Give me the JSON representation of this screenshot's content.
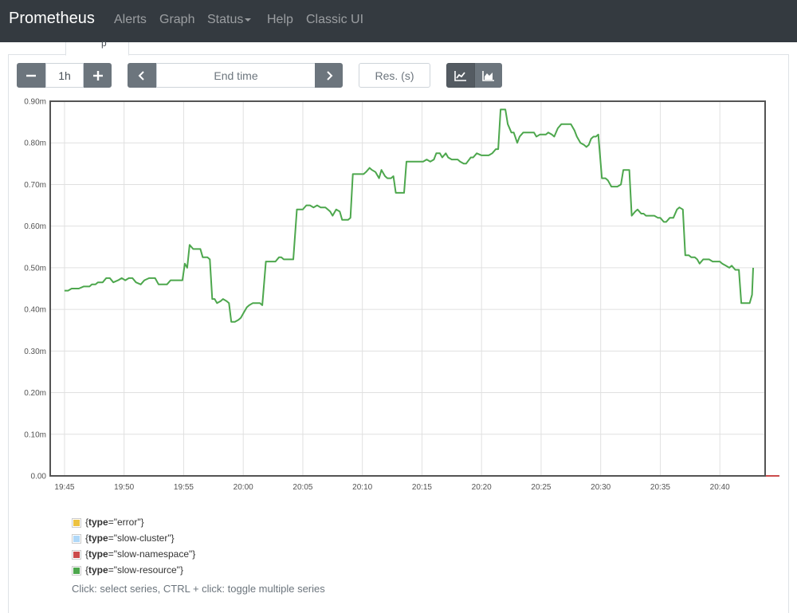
{
  "navbar": {
    "brand": "Prometheus",
    "items": [
      {
        "label": "Alerts"
      },
      {
        "label": "Graph"
      },
      {
        "label": "Status"
      },
      {
        "label": "Help"
      },
      {
        "label": "Classic UI"
      }
    ]
  },
  "tab": {
    "label": "p"
  },
  "controls": {
    "range_value": "1h",
    "decrease_icon": "minus-icon",
    "increase_icon": "plus-icon",
    "end_time_placeholder": "End time",
    "back_icon": "chevron-left-icon",
    "forward_icon": "chevron-right-icon",
    "resolution_placeholder": "Res. (s)",
    "line_mode_icon": "line-chart-icon",
    "stacked_mode_icon": "area-chart-icon"
  },
  "chart_data": {
    "type": "line",
    "ylim": [
      0,
      0.0009
    ],
    "yticks": [
      "0.00",
      "0.10m",
      "0.20m",
      "0.30m",
      "0.40m",
      "0.50m",
      "0.60m",
      "0.70m",
      "0.80m",
      "0.90m"
    ],
    "xticks": [
      "19:45",
      "19:50",
      "19:55",
      "20:00",
      "20:05",
      "20:10",
      "20:15",
      "20:20",
      "20:25",
      "20:30",
      "20:35",
      "20:40"
    ],
    "grid": true,
    "legend_placement": "bottom-left",
    "series": [
      {
        "name": "error",
        "color": "#edc240",
        "points": [
          [
            0,
            0
          ],
          [
            60,
            0
          ]
        ]
      },
      {
        "name": "slow-cluster",
        "color": "#afd8f8",
        "points": [
          [
            0,
            0
          ],
          [
            60,
            0
          ]
        ]
      },
      {
        "name": "slow-namespace",
        "color": "#cb4b4b",
        "points": [
          [
            0,
            0
          ],
          [
            60,
            0
          ]
        ]
      },
      {
        "name": "slow-resource",
        "color": "#4da74d",
        "points": [
          [
            0,
            0.000445
          ],
          [
            0.3,
            0.000445
          ],
          [
            0.6,
            0.00045
          ],
          [
            1.2,
            0.00045
          ],
          [
            1.6,
            0.000455
          ],
          [
            2.1,
            0.000455
          ],
          [
            2.3,
            0.00046
          ],
          [
            2.6,
            0.00046
          ],
          [
            2.8,
            0.000465
          ],
          [
            3.2,
            0.000465
          ],
          [
            3.5,
            0.000475
          ],
          [
            3.8,
            0.000475
          ],
          [
            4.1,
            0.000465
          ],
          [
            4.5,
            0.00047
          ],
          [
            4.8,
            0.000475
          ],
          [
            5.1,
            0.00047
          ],
          [
            5.4,
            0.000475
          ],
          [
            5.7,
            0.000475
          ],
          [
            6.0,
            0.000465
          ],
          [
            6.4,
            0.00046
          ],
          [
            6.7,
            0.00047
          ],
          [
            7.1,
            0.000475
          ],
          [
            7.6,
            0.000475
          ],
          [
            7.9,
            0.00046
          ],
          [
            8.6,
            0.00046
          ],
          [
            8.9,
            0.00047
          ],
          [
            9.6,
            0.00047
          ],
          [
            9.9,
            0.00047
          ],
          [
            10.1,
            0.00051
          ],
          [
            10.3,
            0.0005
          ],
          [
            10.5,
            0.000555
          ],
          [
            10.8,
            0.000545
          ],
          [
            11.2,
            0.000545
          ],
          [
            11.4,
            0.000545
          ],
          [
            11.6,
            0.000525
          ],
          [
            12.0,
            0.000525
          ],
          [
            12.2,
            0.00052
          ],
          [
            12.4,
            0.000425
          ],
          [
            12.6,
            0.000425
          ],
          [
            12.8,
            0.000415
          ],
          [
            13.1,
            0.00042
          ],
          [
            13.3,
            0.000425
          ],
          [
            13.6,
            0.00042
          ],
          [
            13.8,
            0.000415
          ],
          [
            14.0,
            0.00037
          ],
          [
            14.3,
            0.00037
          ],
          [
            14.6,
            0.000375
          ],
          [
            14.8,
            0.00038
          ],
          [
            15.0,
            0.00039
          ],
          [
            15.3,
            0.000405
          ],
          [
            15.5,
            0.00041
          ],
          [
            15.8,
            0.000415
          ],
          [
            16.1,
            0.000415
          ],
          [
            16.4,
            0.000415
          ],
          [
            16.6,
            0.00041
          ],
          [
            16.9,
            0.000515
          ],
          [
            17.2,
            0.000515
          ],
          [
            17.5,
            0.000515
          ],
          [
            17.7,
            0.000515
          ],
          [
            18.0,
            0.000525
          ],
          [
            18.2,
            0.000525
          ],
          [
            18.4,
            0.00052
          ],
          [
            18.7,
            0.00052
          ],
          [
            18.9,
            0.00052
          ],
          [
            19.2,
            0.00052
          ],
          [
            19.5,
            0.00064
          ],
          [
            19.7,
            0.00064
          ],
          [
            20.0,
            0.00064
          ],
          [
            20.3,
            0.00065
          ],
          [
            20.6,
            0.00065
          ],
          [
            20.9,
            0.000645
          ],
          [
            21.2,
            0.00065
          ],
          [
            21.5,
            0.000645
          ],
          [
            21.7,
            0.000645
          ],
          [
            21.9,
            0.000645
          ],
          [
            22.1,
            0.00064
          ],
          [
            22.3,
            0.000635
          ],
          [
            22.5,
            0.000625
          ],
          [
            22.8,
            0.00064
          ],
          [
            23.1,
            0.000635
          ],
          [
            23.3,
            0.000615
          ],
          [
            23.5,
            0.000615
          ],
          [
            23.8,
            0.000615
          ],
          [
            24.0,
            0.00062
          ],
          [
            24.2,
            0.000725
          ],
          [
            24.6,
            0.000725
          ],
          [
            24.9,
            0.000725
          ],
          [
            25.1,
            0.000725
          ],
          [
            25.3,
            0.00073
          ],
          [
            25.6,
            0.00074
          ],
          [
            25.8,
            0.000735
          ],
          [
            26.1,
            0.00073
          ],
          [
            26.4,
            0.000715
          ],
          [
            26.6,
            0.000735
          ],
          [
            26.9,
            0.00072
          ],
          [
            27.1,
            0.000715
          ],
          [
            27.4,
            0.000715
          ],
          [
            27.6,
            0.00072
          ],
          [
            27.8,
            0.00068
          ],
          [
            28.1,
            0.00068
          ],
          [
            28.4,
            0.00068
          ],
          [
            28.5,
            0.00068
          ],
          [
            28.7,
            0.000755
          ],
          [
            29.2,
            0.000755
          ],
          [
            29.6,
            0.000755
          ],
          [
            29.9,
            0.000755
          ],
          [
            30.1,
            0.000755
          ],
          [
            30.4,
            0.00076
          ],
          [
            30.7,
            0.000755
          ],
          [
            31.0,
            0.00076
          ],
          [
            31.2,
            0.000775
          ],
          [
            31.5,
            0.000775
          ],
          [
            31.7,
            0.000765
          ],
          [
            32.0,
            0.000775
          ],
          [
            32.2,
            0.000765
          ],
          [
            32.5,
            0.00076
          ],
          [
            32.8,
            0.00076
          ],
          [
            33.0,
            0.00076
          ],
          [
            33.2,
            0.000755
          ],
          [
            33.5,
            0.00075
          ],
          [
            33.7,
            0.00075
          ],
          [
            34.1,
            0.000765
          ],
          [
            34.3,
            0.000765
          ],
          [
            34.6,
            0.000775
          ],
          [
            35.0,
            0.00077
          ],
          [
            35.2,
            0.00077
          ],
          [
            35.6,
            0.00077
          ],
          [
            35.9,
            0.000775
          ],
          [
            36.2,
            0.000785
          ],
          [
            36.4,
            0.000785
          ],
          [
            36.6,
            0.00088
          ],
          [
            37.0,
            0.00088
          ],
          [
            37.2,
            0.000845
          ],
          [
            37.5,
            0.000825
          ],
          [
            37.7,
            0.000825
          ],
          [
            38.0,
            0.0008
          ],
          [
            38.2,
            0.000815
          ],
          [
            38.5,
            0.000825
          ],
          [
            38.7,
            0.000825
          ],
          [
            38.9,
            0.000825
          ],
          [
            39.2,
            0.000825
          ],
          [
            39.4,
            0.000825
          ],
          [
            39.6,
            0.000815
          ],
          [
            39.9,
            0.00082
          ],
          [
            40.2,
            0.00082
          ],
          [
            40.4,
            0.00082
          ],
          [
            40.6,
            0.000825
          ],
          [
            40.9,
            0.00082
          ],
          [
            41.1,
            0.000815
          ],
          [
            41.4,
            0.000835
          ],
          [
            41.7,
            0.000845
          ],
          [
            42.0,
            0.000845
          ],
          [
            42.3,
            0.000845
          ],
          [
            42.5,
            0.000845
          ],
          [
            42.8,
            0.00083
          ],
          [
            43.0,
            0.000815
          ],
          [
            43.3,
            0.0008
          ],
          [
            43.6,
            0.000795
          ],
          [
            43.8,
            0.00079
          ],
          [
            44.0,
            0.000795
          ],
          [
            44.2,
            0.00081
          ],
          [
            44.4,
            0.000815
          ],
          [
            44.6,
            0.000815
          ],
          [
            44.8,
            0.00082
          ],
          [
            45.1,
            0.000715
          ],
          [
            45.4,
            0.000715
          ],
          [
            45.6,
            0.00071
          ],
          [
            45.9,
            0.000695
          ],
          [
            46.2,
            0.000695
          ],
          [
            46.4,
            0.000695
          ],
          [
            46.7,
            0.0007
          ],
          [
            46.9,
            0.000735
          ],
          [
            47.2,
            0.000735
          ],
          [
            47.4,
            0.000735
          ],
          [
            47.6,
            0.000625
          ],
          [
            47.9,
            0.000635
          ],
          [
            48.1,
            0.00064
          ],
          [
            48.4,
            0.00063
          ],
          [
            48.6,
            0.00063
          ],
          [
            48.8,
            0.000625
          ],
          [
            49.0,
            0.000625
          ],
          [
            49.3,
            0.000625
          ],
          [
            49.5,
            0.000625
          ],
          [
            49.8,
            0.00062
          ],
          [
            50.0,
            0.00062
          ],
          [
            50.3,
            0.00061
          ],
          [
            50.5,
            0.00061
          ],
          [
            50.8,
            0.00062
          ],
          [
            51.1,
            0.00062
          ],
          [
            51.4,
            0.00064
          ],
          [
            51.6,
            0.000645
          ],
          [
            51.9,
            0.00064
          ],
          [
            52.1,
            0.00053
          ],
          [
            52.4,
            0.00053
          ],
          [
            52.6,
            0.000525
          ],
          [
            52.9,
            0.000525
          ],
          [
            53.1,
            0.00052
          ],
          [
            53.3,
            0.00051
          ],
          [
            53.6,
            0.00052
          ],
          [
            53.9,
            0.00052
          ],
          [
            54.1,
            0.00052
          ],
          [
            54.4,
            0.000515
          ],
          [
            54.7,
            0.000515
          ],
          [
            55.0,
            0.000515
          ],
          [
            55.2,
            0.00051
          ],
          [
            55.5,
            0.000505
          ],
          [
            55.8,
            0.0005
          ],
          [
            56.0,
            0.000505
          ],
          [
            56.3,
            0.000495
          ],
          [
            56.6,
            0.000495
          ],
          [
            56.8,
            0.000415
          ],
          [
            57.1,
            0.000415
          ],
          [
            57.3,
            0.000415
          ],
          [
            57.5,
            0.000415
          ],
          [
            57.7,
            0.000435
          ],
          [
            57.8,
            0.0005
          ]
        ]
      }
    ]
  },
  "legend": {
    "key": "type",
    "values": [
      "\"error\"",
      "\"slow-cluster\"",
      "\"slow-namespace\"",
      "\"slow-resource\""
    ]
  },
  "hint": "Click: select series, CTRL + click: toggle multiple series"
}
